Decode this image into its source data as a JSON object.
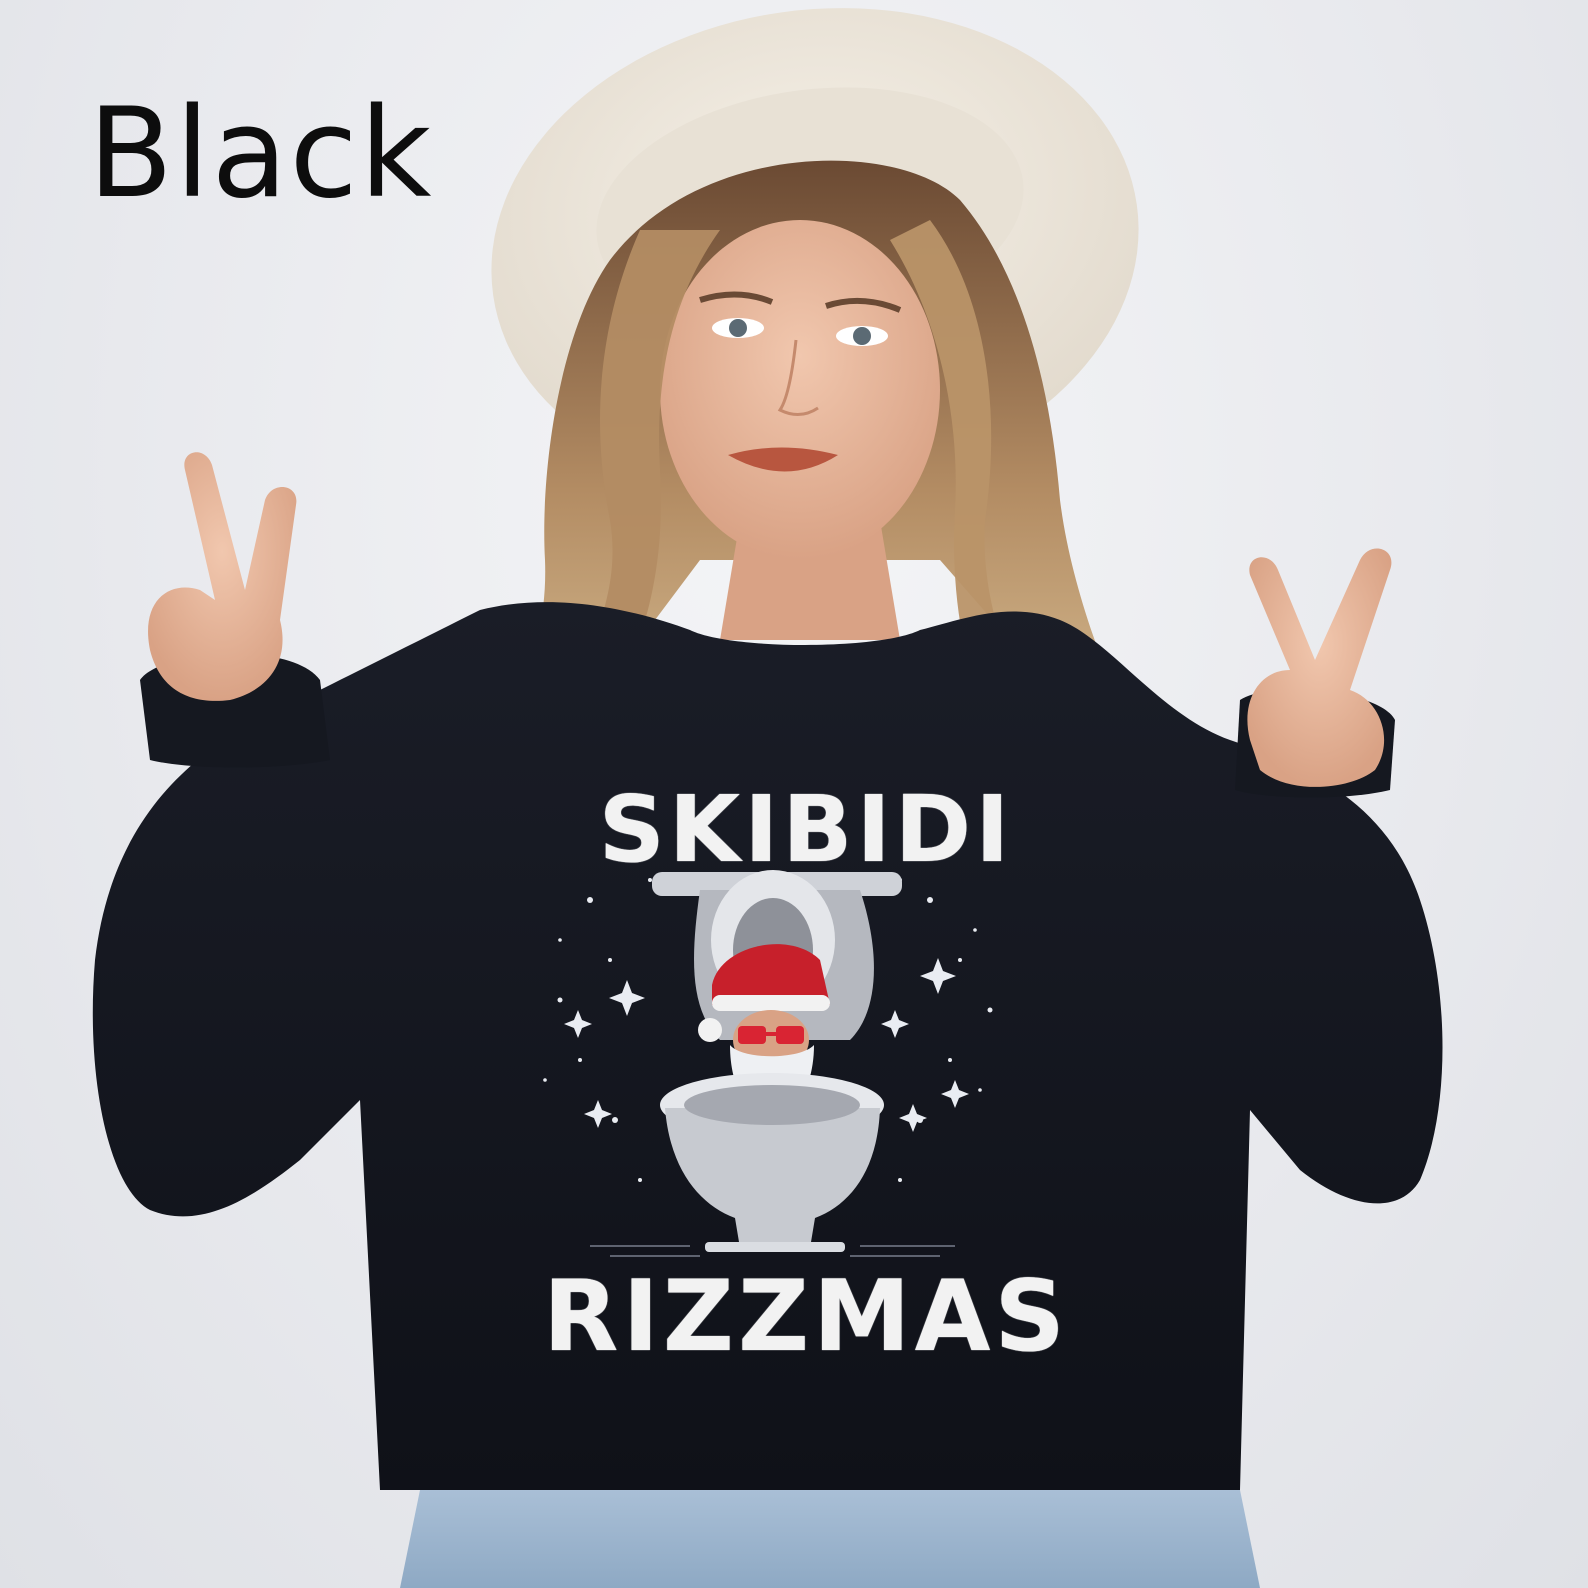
{
  "color_label": "Black",
  "shirt_print": {
    "line1": "SKIBIDI",
    "line2": "RIZZMAS"
  }
}
